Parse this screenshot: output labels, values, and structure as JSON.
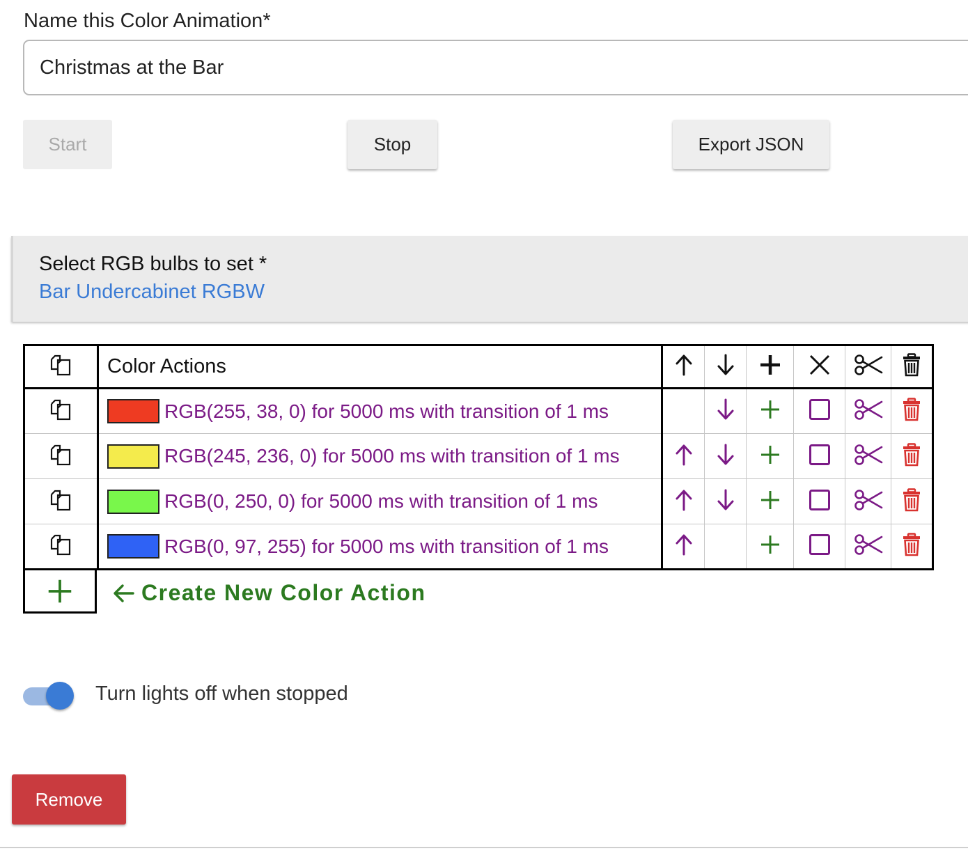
{
  "form": {
    "name_label": "Name this Color Animation*",
    "name_value": "Christmas at the Bar"
  },
  "buttons": {
    "start": "Start",
    "stop": "Stop",
    "export": "Export JSON",
    "remove": "Remove"
  },
  "bulbs": {
    "label": "Select RGB bulbs to set *",
    "selected": "Bar Undercabinet RGBW"
  },
  "table": {
    "header": {
      "title": "Color Actions",
      "icons": [
        "copy-icon",
        "arrow-up-icon",
        "arrow-down-icon",
        "plus-icon",
        "close-icon",
        "scissors-icon",
        "trash-icon"
      ]
    },
    "rows": [
      {
        "swatch": "#ee3b22",
        "text": "RGB(255, 38, 0) for 5000 ms with transition of 1 ms",
        "move_up": false,
        "move_down": true
      },
      {
        "swatch": "#f4eb4c",
        "text": "RGB(245, 236, 0) for 5000 ms with transition of 1 ms",
        "move_up": true,
        "move_down": true
      },
      {
        "swatch": "#79f74b",
        "text": "RGB(0, 250, 0) for 5000 ms with transition of 1 ms",
        "move_up": true,
        "move_down": true
      },
      {
        "swatch": "#2f62f5",
        "text": "RGB(0, 97, 255) for 5000 ms with transition of 1 ms",
        "move_up": true,
        "move_down": false
      }
    ],
    "create_label": "Create New Color Action"
  },
  "toggle": {
    "label": "Turn lights off when stopped",
    "checked": true
  },
  "colors": {
    "accent_blue": "#3a7bd5",
    "action_purple": "#7b1a86",
    "add_green": "#2c7a20",
    "delete_red": "#d8322f",
    "remove_red": "#c93b3f"
  }
}
